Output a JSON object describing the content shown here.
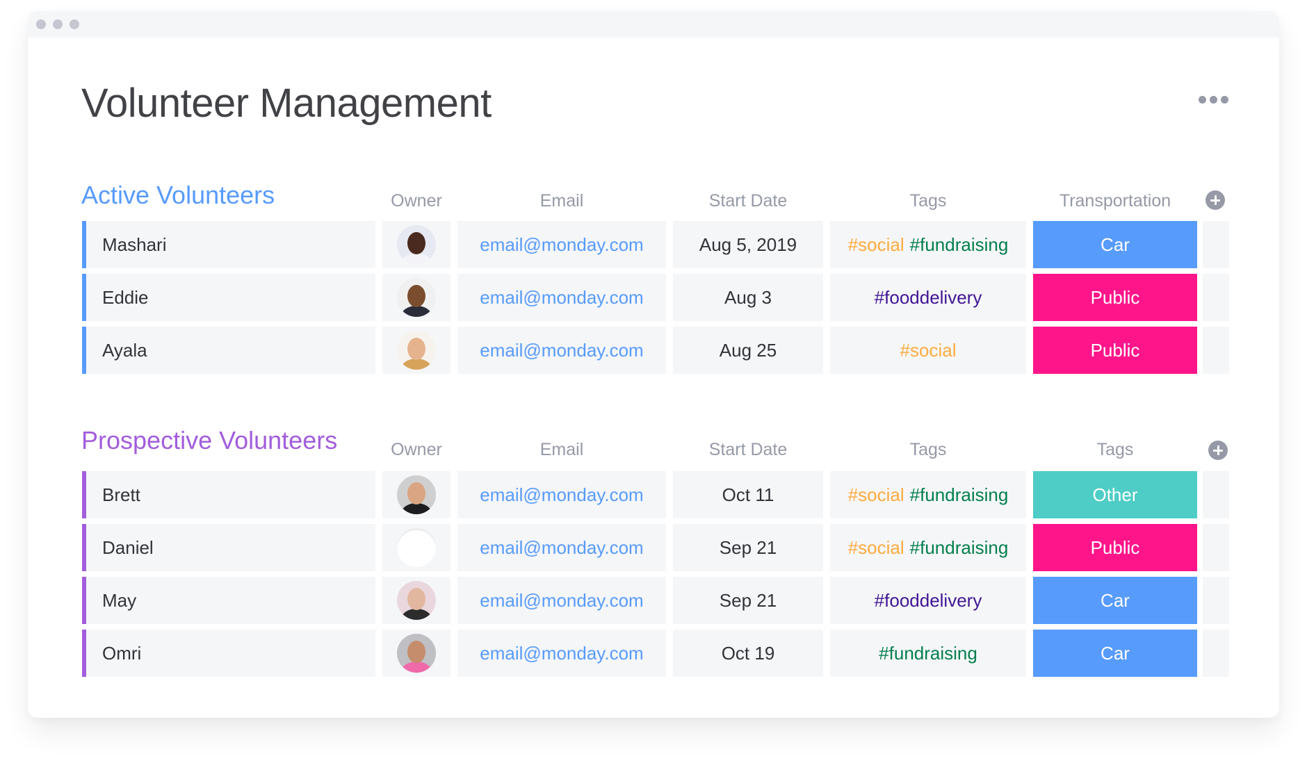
{
  "window": {
    "title": "Volunteer Management",
    "more_icon": "more-horizontal-icon"
  },
  "colors": {
    "accent_blue": "#579bfc",
    "accent_purple": "#a25ddc",
    "status_car": "#579bfc",
    "status_public": "#ff158a",
    "status_other": "#4eccc6",
    "tag_social": "#fdab3d",
    "tag_fundraising": "#037f4c",
    "tag_fooddelivery": "#401694",
    "email_link": "#579bfc",
    "header_text": "#9699a6",
    "cell_bg": "#f5f6f8"
  },
  "groups": [
    {
      "title": "Active Volunteers",
      "color": "#579bfc",
      "columns": [
        "Owner",
        "Email",
        "Start Date",
        "Tags",
        "Transportation"
      ],
      "add_column_icon": "plus-circle-icon",
      "rows": [
        {
          "name": "Mashari",
          "avatar": "owner-avatar-mashari",
          "email": "email@monday.com",
          "start_date": "Aug 5, 2019",
          "tags": [
            "#social",
            "#fundraising"
          ],
          "status": "Car"
        },
        {
          "name": "Eddie",
          "avatar": "owner-avatar-eddie",
          "email": "email@monday.com",
          "start_date": "Aug 3",
          "tags": [
            "#fooddelivery"
          ],
          "status": "Public"
        },
        {
          "name": "Ayala",
          "avatar": "owner-avatar-ayala",
          "email": "email@monday.com",
          "start_date": "Aug 25",
          "tags": [
            "#social"
          ],
          "status": "Public"
        }
      ]
    },
    {
      "title": "Prospective Volunteers",
      "color": "#a25ddc",
      "columns": [
        "Owner",
        "Email",
        "Start Date",
        "Tags",
        "Tags"
      ],
      "add_column_icon": "plus-circle-icon",
      "rows": [
        {
          "name": "Brett",
          "avatar": "owner-avatar-brett",
          "email": "email@monday.com",
          "start_date": "Oct 11",
          "tags": [
            "#social",
            "#fundraising"
          ],
          "status": "Other"
        },
        {
          "name": "Daniel",
          "avatar": "owner-avatar-daniel",
          "email": "email@monday.com",
          "start_date": "Sep 21",
          "tags": [
            "#social",
            "#fundraising"
          ],
          "status": "Public"
        },
        {
          "name": "May",
          "avatar": "owner-avatar-may",
          "email": "email@monday.com",
          "start_date": "Sep 21",
          "tags": [
            "#fooddelivery"
          ],
          "status": "Car"
        },
        {
          "name": "Omri",
          "avatar": "owner-avatar-omri",
          "email": "email@monday.com",
          "start_date": "Oct 19",
          "tags": [
            "#fundraising"
          ],
          "status": "Car"
        }
      ]
    }
  ]
}
